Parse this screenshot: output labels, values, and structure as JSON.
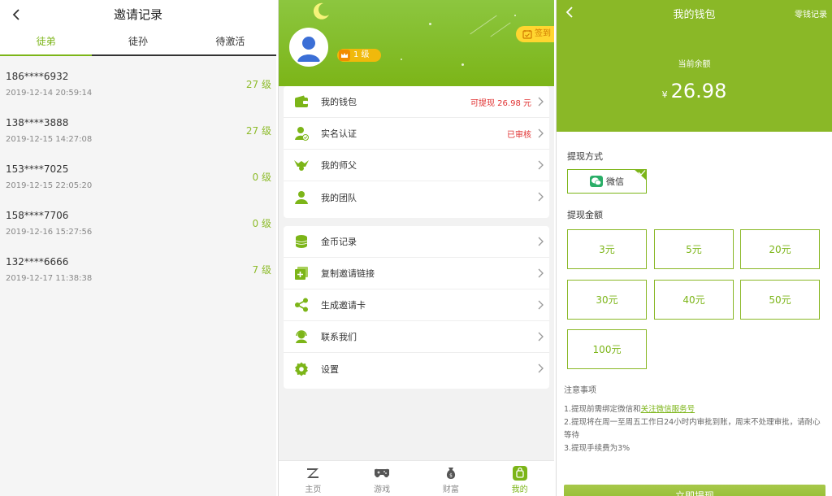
{
  "invite_panel": {
    "title": "邀请记录",
    "tabs": [
      {
        "label": "徒弟",
        "active": true
      },
      {
        "label": "徒孙",
        "active": false
      },
      {
        "label": "待激活",
        "active": false
      }
    ],
    "records": [
      {
        "phone": "186****6932",
        "time": "2019-12-14 20:59:14",
        "level": "27 级"
      },
      {
        "phone": "138****3888",
        "time": "2019-12-15 14:27:08",
        "level": "27 级"
      },
      {
        "phone": "153****7025",
        "time": "2019-12-15 22:05:20",
        "level": "0 级"
      },
      {
        "phone": "158****7706",
        "time": "2019-12-16 15:27:56",
        "level": "0 级"
      },
      {
        "phone": "132****6666",
        "time": "2019-12-17 11:38:38",
        "level": "7 级"
      }
    ]
  },
  "profile_panel": {
    "level_badge": "1 级",
    "signin_label": "签到",
    "menu_group_1": [
      {
        "icon": "wallet-icon",
        "label": "我的钱包",
        "value": "可提现 26.98 元"
      },
      {
        "icon": "id-verify-icon",
        "label": "实名认证",
        "value": "已审核"
      },
      {
        "icon": "master-icon",
        "label": "我的师父",
        "value": ""
      },
      {
        "icon": "team-icon",
        "label": "我的团队",
        "value": ""
      }
    ],
    "menu_group_2": [
      {
        "icon": "coins-icon",
        "label": "金币记录"
      },
      {
        "icon": "copy-link-icon",
        "label": "复制邀请链接"
      },
      {
        "icon": "share-icon",
        "label": "生成邀请卡"
      },
      {
        "icon": "customer-service-icon",
        "label": "联系我们"
      },
      {
        "icon": "gear-icon",
        "label": "设置"
      }
    ],
    "tabbar": [
      {
        "icon": "home-icon",
        "label": "主页",
        "active": false
      },
      {
        "icon": "gamepad-icon",
        "label": "游戏",
        "active": false
      },
      {
        "icon": "money-bag-icon",
        "label": "财富",
        "active": false
      },
      {
        "icon": "my-icon",
        "label": "我的",
        "active": true
      }
    ],
    "accent_color": "#7cb518"
  },
  "wallet_panel": {
    "title": "我的钱包",
    "change_record": "零钱记录",
    "balance_label": "当前余额",
    "currency": "¥",
    "balance": "26.98",
    "method_title": "提现方式",
    "method_label": "微信",
    "amount_title": "提现金额",
    "amounts": [
      "3元",
      "5元",
      "20元",
      "30元",
      "40元",
      "50元",
      "100元"
    ],
    "notes_title": "注意事项",
    "note_1_prefix": "1.提现前需绑定微信和",
    "note_1_link": "关注微信服务号",
    "note_2": "2.提现将在周一至周五工作日24小时内审批到账，周末不处理审批，请耐心等待",
    "note_3": "3.提现手续费为3%",
    "withdraw_button": "立即提现",
    "header_color": "#8ab827"
  }
}
